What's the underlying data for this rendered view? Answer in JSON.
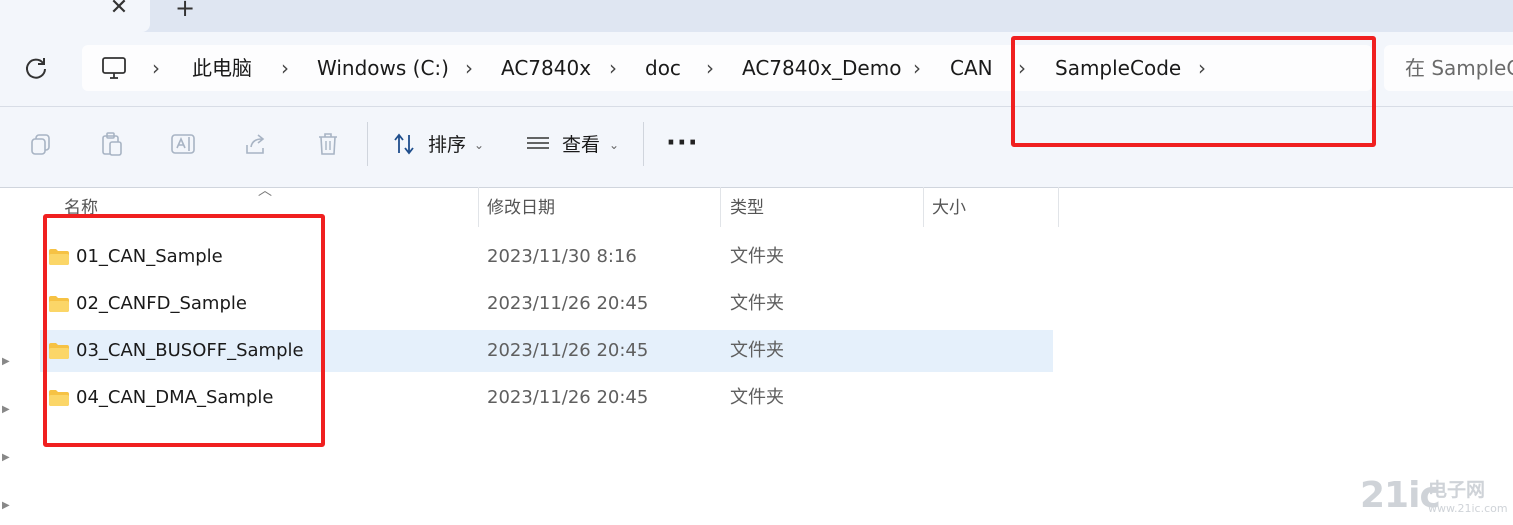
{
  "tabs": {
    "close_glyph": "✕",
    "new_glyph": "+"
  },
  "breadcrumb": {
    "items": [
      "此电脑",
      "Windows (C:)",
      "AC7840x",
      "doc",
      "AC7840x_Demo",
      "CAN",
      "SampleCode"
    ],
    "separator": "›"
  },
  "search": {
    "placeholder": "在 SampleC"
  },
  "toolbar": {
    "sort_label": "排序",
    "view_label": "查看",
    "more_label": "···",
    "caret": "⌄"
  },
  "columns": {
    "name": "名称",
    "modified": "修改日期",
    "type": "类型",
    "size": "大小"
  },
  "files": [
    {
      "name": "01_CAN_Sample",
      "modified": "2023/11/30 8:16",
      "type": "文件夹"
    },
    {
      "name": "02_CANFD_Sample",
      "modified": "2023/11/26 20:45",
      "type": "文件夹"
    },
    {
      "name": "03_CAN_BUSOFF_Sample",
      "modified": "2023/11/26 20:45",
      "type": "文件夹",
      "selected": true
    },
    {
      "name": "04_CAN_DMA_Sample",
      "modified": "2023/11/26 20:45",
      "type": "文件夹"
    }
  ],
  "watermark": {
    "logo": "21ic",
    "cn": "电子网",
    "sub": "www.21ic.com"
  },
  "colors": {
    "annotation_red": "#f02020",
    "selected_row": "#e5f0fb",
    "folder_yellow": "#f6c244"
  }
}
